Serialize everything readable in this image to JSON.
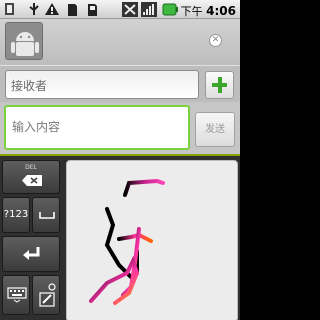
{
  "status_bar": {
    "time_period": "下午",
    "time": "4:06",
    "icons": [
      "android-debug-icon",
      "usb-icon",
      "warning-icon",
      "sdcard-icon",
      "mute-icon",
      "signal-icon",
      "battery-icon"
    ]
  },
  "header": {
    "avatar_icon": "android-contact-icon",
    "close_icon": "close-icon"
  },
  "recipient": {
    "placeholder": "接收者",
    "add_icon": "plus-icon"
  },
  "compose": {
    "placeholder": "输入内容",
    "send_label": "发送",
    "focus_color": "#7bd140"
  },
  "ime": {
    "del_label": "DEL",
    "symbols_label": "?123",
    "accent_color": "#8aa000",
    "stroke_colors": [
      "#000000",
      "#ff3399",
      "#ff9900"
    ]
  }
}
